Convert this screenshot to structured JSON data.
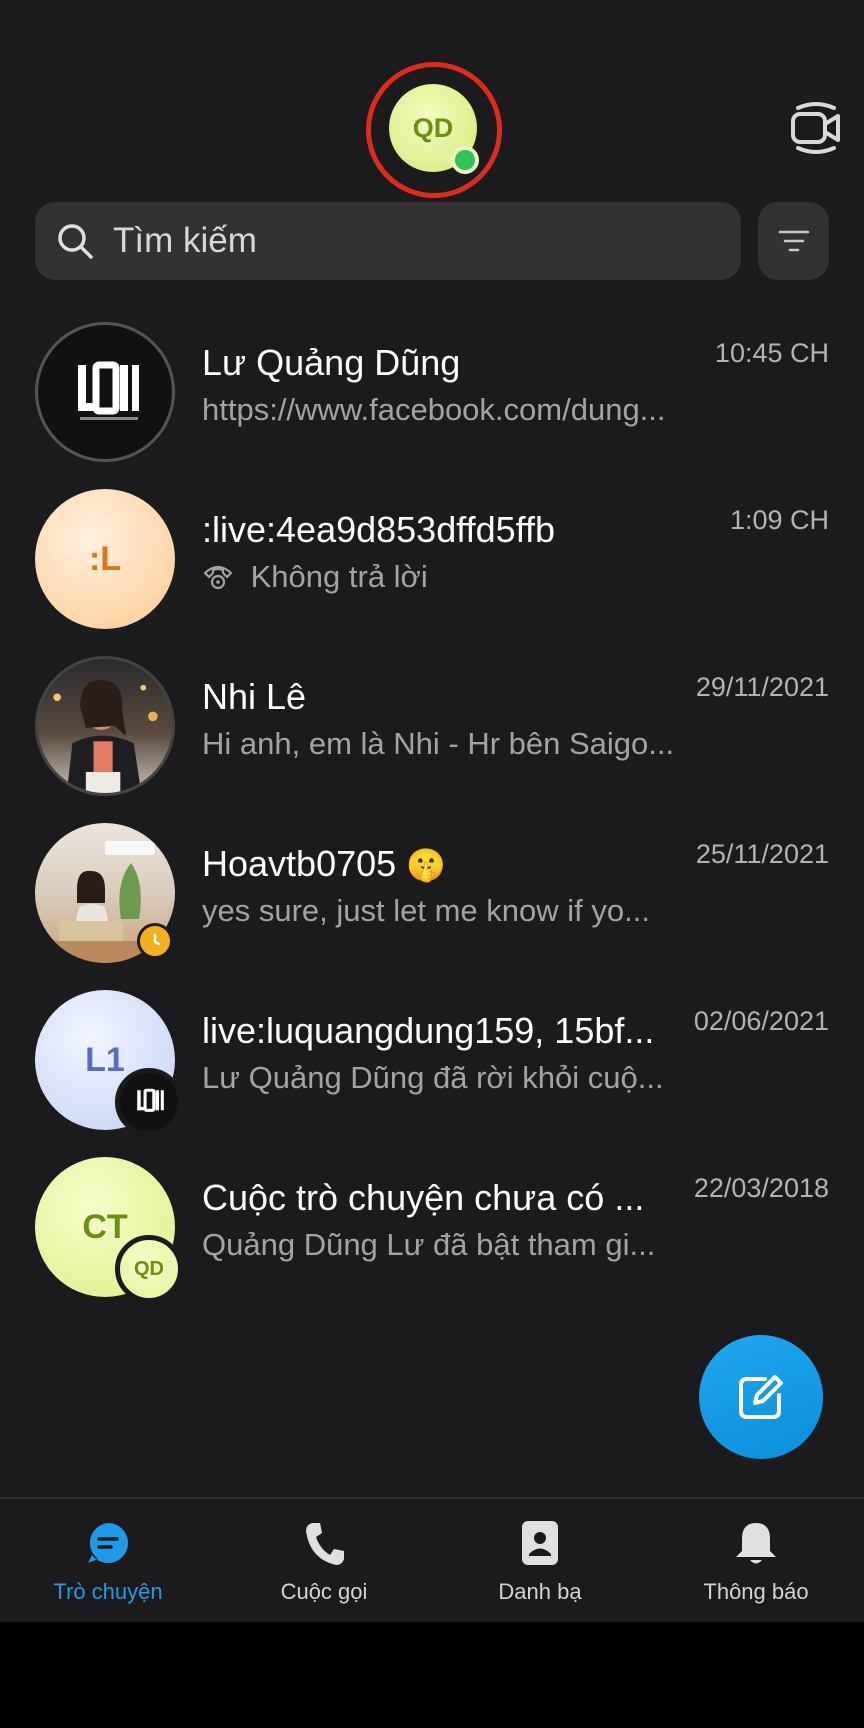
{
  "header": {
    "me_avatar_initials": "QD",
    "me_avatar_color": "#e0f293",
    "presence_color": "#2ec55a",
    "highlight_color": "#e02a1b",
    "video_icon": "video-camera-icon"
  },
  "search": {
    "placeholder": "Tìm kiếm",
    "icon": "search-icon",
    "filter_icon": "filter-icon"
  },
  "chats": [
    {
      "name": "Lư Quảng Dũng",
      "preview": "https://www.facebook.com/dung...",
      "time": "10:45 CH",
      "avatar": "logo-image",
      "avatar_logo_text": "LQD"
    },
    {
      "name": ":live:4ea9d853dffd5ffb",
      "preview": "Không trả lời",
      "preview_icon": "missed-call-icon",
      "time": "1:09 CH",
      "avatar_initials": ":L"
    },
    {
      "name": "Nhi Lê",
      "preview": "Hi anh, em là Nhi - Hr bên Saigo...",
      "time": "29/11/2021",
      "avatar": "photo"
    },
    {
      "name": "Hoavtb0705",
      "name_emoji": "🤫",
      "preview": "yes sure, just let me know if yo...",
      "time": "25/11/2021",
      "avatar": "photo",
      "status_badge": "clock-icon"
    },
    {
      "name": "live:luquangdung159, 15bf...",
      "preview": "Lư Quảng Dũng đã rời khỏi cuộ...",
      "time": "02/06/2021",
      "avatar_initials": "L1",
      "sub_avatar": "logo-image"
    },
    {
      "name": "Cuộc trò chuyện chưa có ...",
      "preview": "Quảng Dũng Lư đã bật tham gi...",
      "time": "22/03/2018",
      "avatar_initials": "CT",
      "sub_avatar_initials": "QD"
    }
  ],
  "fab": {
    "icon": "compose-icon",
    "color": "#0a8fdc"
  },
  "nav": [
    {
      "label": "Trò chuyện",
      "icon": "chat-bubble-icon",
      "active": true
    },
    {
      "label": "Cuộc gọi",
      "icon": "phone-icon",
      "active": false
    },
    {
      "label": "Danh bạ",
      "icon": "contacts-book-icon",
      "active": false
    },
    {
      "label": "Thông báo",
      "icon": "bell-icon",
      "active": false
    }
  ],
  "accent_color": "#1e9be8"
}
